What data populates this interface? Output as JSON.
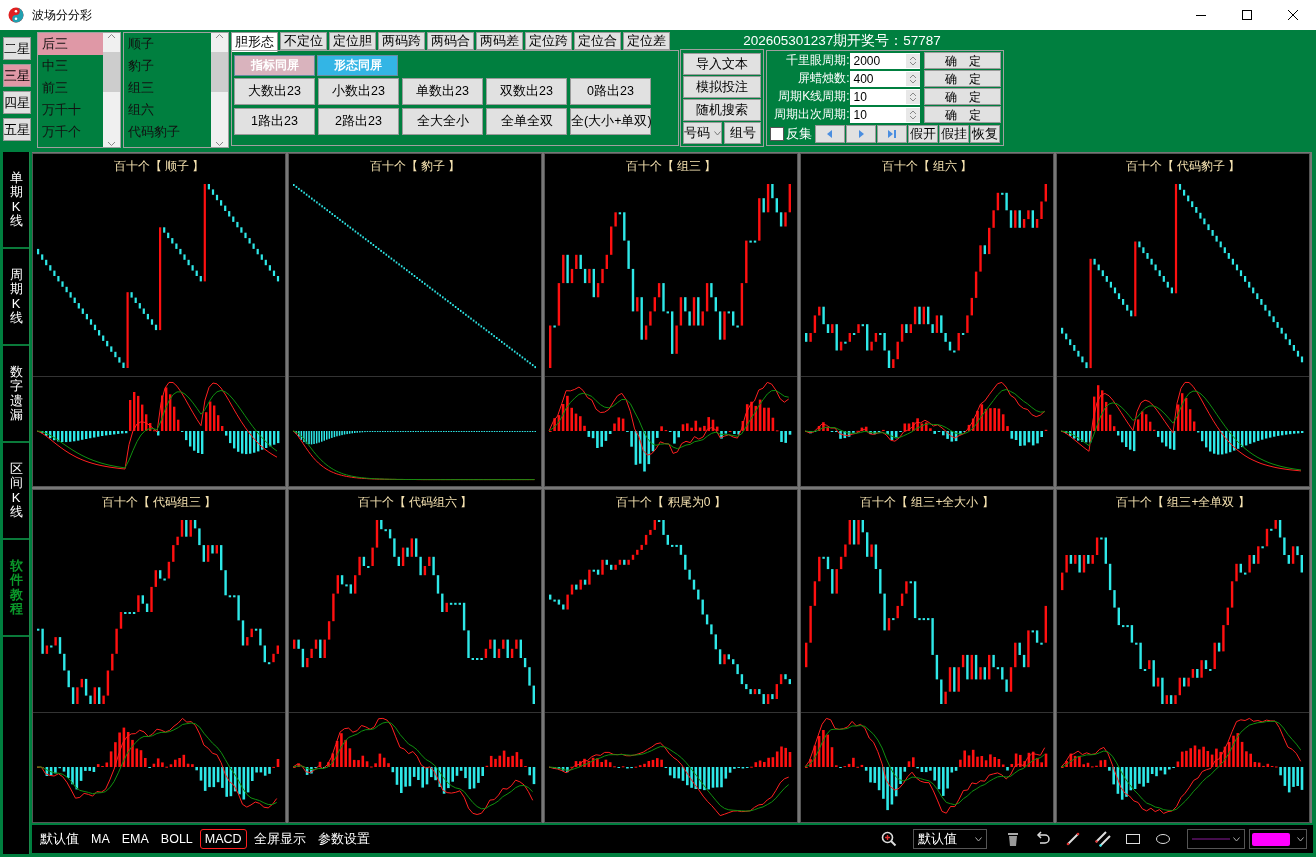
{
  "window": {
    "title": "波场分分彩"
  },
  "star_buttons": [
    {
      "label": "二星",
      "selected": false
    },
    {
      "label": "三星",
      "selected": true
    },
    {
      "label": "四星",
      "selected": false
    },
    {
      "label": "五星",
      "selected": false
    }
  ],
  "position_list": [
    {
      "label": "后三",
      "selected": true
    },
    {
      "label": "中三",
      "selected": false
    },
    {
      "label": "前三",
      "selected": false
    },
    {
      "label": "万千十",
      "selected": false
    },
    {
      "label": "万千个",
      "selected": false
    }
  ],
  "pattern_list": [
    {
      "label": "顺子",
      "selected": false
    },
    {
      "label": "豹子",
      "selected": false
    },
    {
      "label": "组三",
      "selected": false
    },
    {
      "label": "组六",
      "selected": false
    },
    {
      "label": "代码豹子",
      "selected": false
    }
  ],
  "tabs": [
    {
      "label": "胆形态",
      "selected": true
    },
    {
      "label": "不定位",
      "selected": false
    },
    {
      "label": "定位胆",
      "selected": false
    },
    {
      "label": "两码跨",
      "selected": false
    },
    {
      "label": "两码合",
      "selected": false
    },
    {
      "label": "两码差",
      "selected": false
    },
    {
      "label": "定位跨",
      "selected": false
    },
    {
      "label": "定位合",
      "selected": false
    },
    {
      "label": "定位差",
      "selected": false
    }
  ],
  "mode_buttons": [
    {
      "label": "指标同屏",
      "color": "#d9b3bd"
    },
    {
      "label": "形态同屏",
      "color": "#33b5e5"
    }
  ],
  "filter_buttons": [
    "大数出23",
    "小数出23",
    "单数出23",
    "双数出23",
    "0路出23",
    "1路出23",
    "2路出23",
    "全大全小",
    "全单全双",
    "全(大小+单双)"
  ],
  "action_buttons": [
    "导入文本",
    "模拟投注",
    "随机搜索"
  ],
  "number_select": {
    "value": "号码"
  },
  "group_button": "组号",
  "draw_info": "202605301237期开奖号：57787",
  "params": [
    {
      "label": "千里眼周期:",
      "value": "2000",
      "button": "确　定"
    },
    {
      "label": "屏蜡烛数:",
      "value": "400",
      "button": "确　定"
    },
    {
      "label": "周期K线周期:",
      "value": "10",
      "button": "确　定"
    },
    {
      "label": "周期出次周期:",
      "value": "10",
      "button": "确　定"
    }
  ],
  "reverse_checkbox": {
    "label": "反集",
    "checked": false
  },
  "fake_buttons": [
    "假开",
    "假挂",
    "恢复"
  ],
  "side_tabs": [
    {
      "label": "单期K线",
      "kind": "tab"
    },
    {
      "label": "周期K线",
      "kind": "tab"
    },
    {
      "label": "数字遗漏",
      "kind": "tab"
    },
    {
      "label": "区间K线",
      "kind": "tab"
    },
    {
      "label": "软件教程",
      "kind": "link"
    }
  ],
  "charts": [
    {
      "title": "百十个【 顺子 】"
    },
    {
      "title": "百十个【 豹子 】"
    },
    {
      "title": "百十个【 组三 】"
    },
    {
      "title": "百十个【 组六 】"
    },
    {
      "title": "百十个【 代码豹子 】"
    },
    {
      "title": "百十个【 代码组三 】"
    },
    {
      "title": "百十个【 代码组六 】"
    },
    {
      "title": "百十个【 积尾为0 】"
    },
    {
      "title": "百十个【 组三+全大小 】"
    },
    {
      "title": "百十个【 组三+全单双 】"
    }
  ],
  "indicators": [
    {
      "label": "默认值",
      "selected": false
    },
    {
      "label": "MA",
      "selected": false
    },
    {
      "label": "EMA",
      "selected": false
    },
    {
      "label": "BOLL",
      "selected": false
    },
    {
      "label": "MACD",
      "selected": true
    },
    {
      "label": "全屏显示",
      "selected": false
    },
    {
      "label": "参数设置",
      "selected": false
    }
  ],
  "preset_select": {
    "value": "默认值"
  },
  "color_select": {
    "color": "#ff00ff"
  }
}
